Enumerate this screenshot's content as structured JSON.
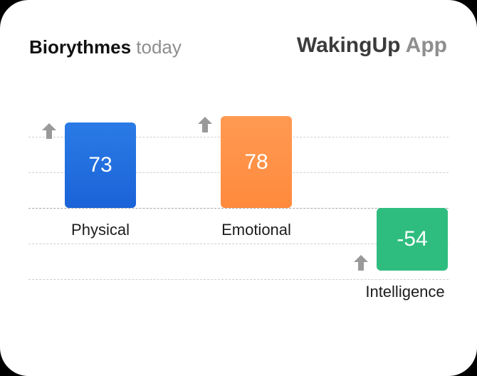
{
  "header": {
    "title_main": "Biorythmes",
    "title_sub": "today",
    "brand_main": "WakingUp",
    "brand_sub": "App"
  },
  "icons": {
    "trend": "arrow-up-icon"
  },
  "colors": {
    "physical": "#1f6fe0",
    "emotional": "#ff8a3d",
    "intelligence": "#2fbd7f",
    "arrow": "#9a9a9a"
  },
  "chart_data": {
    "type": "bar",
    "categories": [
      "Physical",
      "Emotional",
      "Intelligence"
    ],
    "values": [
      73,
      78,
      -54
    ],
    "value_labels": [
      "73",
      "78",
      "-54"
    ],
    "trend": [
      "up",
      "up",
      "up"
    ],
    "ylim": [
      -100,
      100
    ],
    "grid": true
  }
}
